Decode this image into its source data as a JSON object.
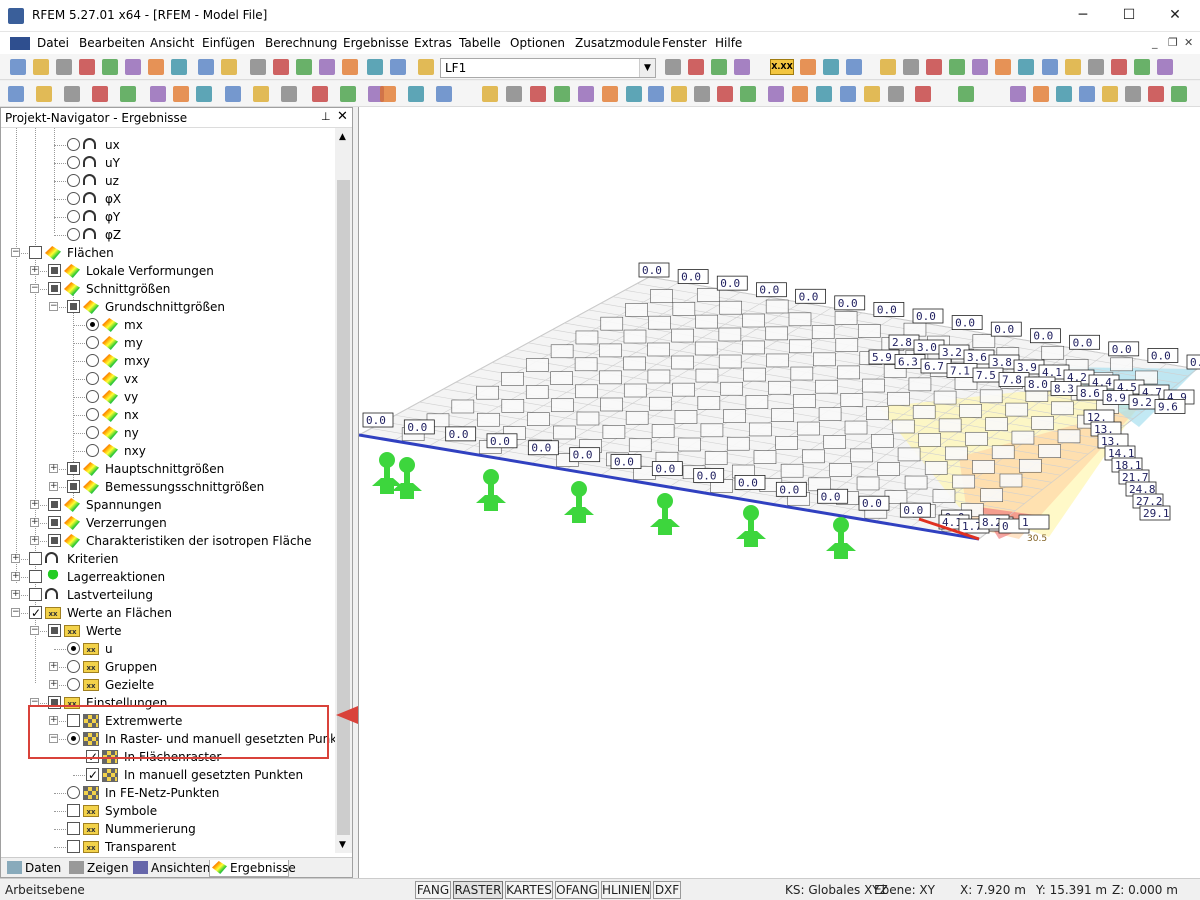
{
  "window": {
    "title": "RFEM 5.27.01 x64 - [RFEM - Model File]"
  },
  "menu": [
    "Datei",
    "Bearbeiten",
    "Ansicht",
    "Einfügen",
    "Berechnung",
    "Ergebnisse",
    "Extras",
    "Tabelle",
    "Optionen",
    "Zusatzmodule",
    "Fenster",
    "Hilfe"
  ],
  "toolbar": {
    "load_case": "LF1",
    "values_button": "X.XX"
  },
  "navigator": {
    "title": "Projekt-Navigator - Ergebnisse",
    "items": [
      {
        "label": "ux",
        "state": "radio"
      },
      {
        "label": "uY",
        "state": "radio"
      },
      {
        "label": "uz",
        "state": "radio"
      },
      {
        "label": "φX",
        "state": "radio"
      },
      {
        "label": "φY",
        "state": "radio"
      },
      {
        "label": "φZ",
        "state": "radio"
      },
      {
        "label": "Flächen",
        "state": "unchecked"
      },
      {
        "label": "Lokale Verformungen",
        "state": "partial"
      },
      {
        "label": "Schnittgrößen",
        "state": "partial"
      },
      {
        "label": "Grundschnittgrößen",
        "state": "partial"
      },
      {
        "label": "mx",
        "state": "radio-on"
      },
      {
        "label": "my",
        "state": "radio"
      },
      {
        "label": "mxy",
        "state": "radio"
      },
      {
        "label": "vx",
        "state": "radio"
      },
      {
        "label": "vy",
        "state": "radio"
      },
      {
        "label": "nx",
        "state": "radio"
      },
      {
        "label": "ny",
        "state": "radio"
      },
      {
        "label": "nxy",
        "state": "radio"
      },
      {
        "label": "Hauptschnittgrößen",
        "state": "partial"
      },
      {
        "label": "Bemessungsschnittgrößen",
        "state": "partial"
      },
      {
        "label": "Spannungen",
        "state": "partial"
      },
      {
        "label": "Verzerrungen",
        "state": "partial"
      },
      {
        "label": "Charakteristiken der isotropen Fläche",
        "state": "partial"
      },
      {
        "label": "Kriterien",
        "state": "unchecked"
      },
      {
        "label": "Lagerreaktionen",
        "state": "unchecked"
      },
      {
        "label": "Lastverteilung",
        "state": "unchecked"
      },
      {
        "label": "Werte an Flächen",
        "state": "checked"
      },
      {
        "label": "Werte",
        "state": "partial"
      },
      {
        "label": "u",
        "state": "radio-on"
      },
      {
        "label": "Gruppen",
        "state": "radio"
      },
      {
        "label": "Gezielte",
        "state": "radio"
      },
      {
        "label": "Einstellungen",
        "state": "partial"
      },
      {
        "label": "Extremwerte",
        "state": "unchecked"
      },
      {
        "label": "In Raster- und manuell gesetzten Punkten",
        "state": "radio-on"
      },
      {
        "label": "In Flächenraster",
        "state": "checked"
      },
      {
        "label": "In manuell gesetzten Punkten",
        "state": "checked"
      },
      {
        "label": "In FE-Netz-Punkten",
        "state": "radio"
      },
      {
        "label": "Symbole",
        "state": "unchecked"
      },
      {
        "label": "Nummerierung",
        "state": "unchecked"
      },
      {
        "label": "Transparent",
        "state": "unchecked"
      }
    ],
    "tabs": [
      "Daten",
      "Zeigen",
      "Ansichten",
      "Ergebnisse"
    ]
  },
  "viewport": {
    "labels_row1": [
      "0.0",
      "0.0",
      "0.0",
      "0.0",
      "0.0",
      "0.0",
      "0.0",
      "0.0",
      "0.0",
      "0.0",
      "0.0",
      "0.0",
      "0.0",
      "0.0",
      "0.0",
      "0.0"
    ],
    "labels_back": [
      "0.0",
      "0.0",
      "0.0",
      "0.0",
      "0.0",
      "0.0",
      "0.0",
      "0.0",
      "0.0",
      "0.0",
      "0.0",
      "0.0",
      "0.0",
      "0.0",
      "0.0"
    ],
    "labels_right": [
      "2.8",
      "3.0",
      "3.2",
      "3.6",
      "3.8",
      "3.9",
      "4.1",
      "4.2",
      "4.4",
      "4.5",
      "4.7",
      "4.9"
    ],
    "labels_mid": [
      "5.9",
      "6.3",
      "6.7",
      "7.1",
      "7.5",
      "7.8",
      "8.0",
      "8.3",
      "8.6",
      "8.9",
      "9.2",
      "9.6"
    ],
    "labels_far": [
      "12.",
      "13.",
      "13.",
      "14.1",
      "18.1",
      "21.7",
      "24.8",
      "27.2",
      "29.1"
    ],
    "labels_front": [
      "4.1",
      "1.7",
      "8.2",
      "0",
      "1"
    ],
    "max_value": "30.5"
  },
  "status": {
    "left": "Arbeitsebene",
    "buttons": [
      "FANG",
      "RASTER",
      "KARTES",
      "OFANG",
      "HLINIEN",
      "DXF"
    ],
    "active": "RASTER",
    "ks": "KS: Globales XYZ",
    "plane": "Ebene: XY",
    "x": "X:  7.920 m",
    "y": "Y:  15.391 m",
    "z": "Z:  0.000 m"
  }
}
